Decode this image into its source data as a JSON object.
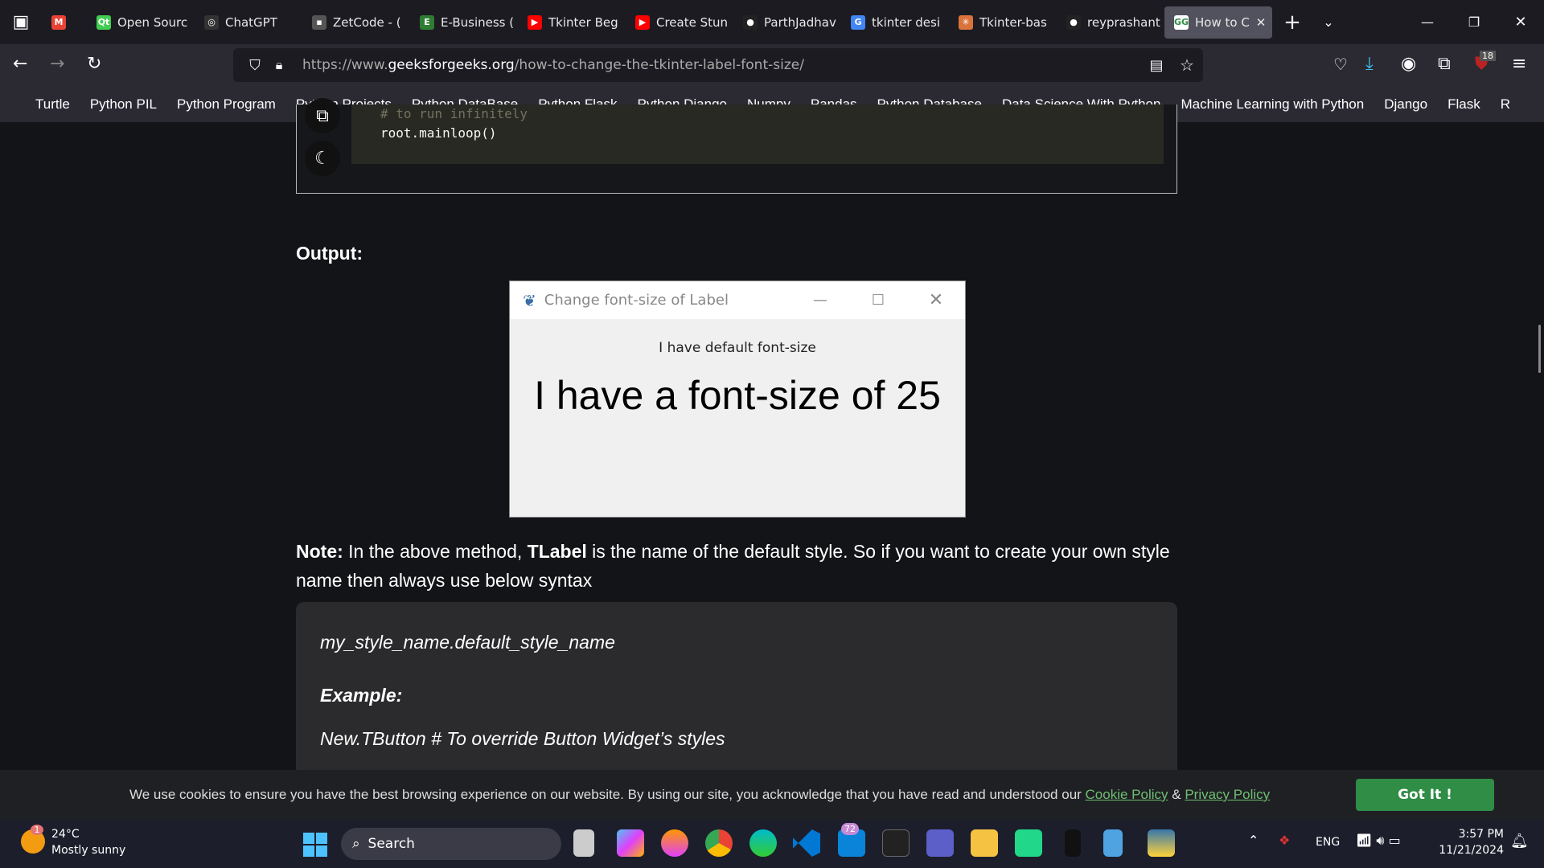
{
  "tabs": [
    {
      "label": "",
      "color": "#e94235",
      "icon": "M"
    },
    {
      "label": "Open Sourc",
      "color": "#41cd52",
      "icon": "Qt"
    },
    {
      "label": "ChatGPT",
      "color": "#333",
      "icon": "◎"
    },
    {
      "label": "ZetCode - (",
      "color": "#555",
      "icon": "▪"
    },
    {
      "label": "E-Business (",
      "color": "#2e7d32",
      "icon": "E"
    },
    {
      "label": "Tkinter Beg",
      "color": "#f00",
      "icon": "▶"
    },
    {
      "label": "Create Stun",
      "color": "#f00",
      "icon": "▶"
    },
    {
      "label": "ParthJadhav",
      "color": "#222",
      "icon": "●"
    },
    {
      "label": "tkinter desi",
      "color": "#4285f4",
      "icon": "G"
    },
    {
      "label": "Tkinter-bas",
      "color": "#d9733b",
      "icon": "✳"
    },
    {
      "label": "reyprashant",
      "color": "#222",
      "icon": "●"
    },
    {
      "label": "How to C",
      "color": "#fff",
      "icon": "GG",
      "active": true
    }
  ],
  "url": {
    "prefix": "https://www.",
    "domain": "geeksforgeeks.org",
    "path": "/how-to-change-the-tkinter-label-font-size/"
  },
  "extensions_badge": "18",
  "bookmarks": [
    "Turtle",
    "Python PIL",
    "Python Program",
    "Python Projects",
    "Python DataBase",
    "Python Flask",
    "Python Django",
    "Numpy",
    "Pandas",
    "Python Database",
    "Data Science With Python",
    "Machine Learning with Python",
    "Django",
    "Flask",
    "R"
  ],
  "code": {
    "comment": "# to run infinitely",
    "line": "root.mainloop()"
  },
  "output_heading": "Output:",
  "tk_window": {
    "title": "Change font-size of Label",
    "label_default": "I have default font-size",
    "label_big": "I have a font-size of 25"
  },
  "note": {
    "bold": "Note:",
    "text1": " In the above method, ",
    "bold2": "TLabel",
    "text2": " is the name of the default style. So if you want to create your own style name then always use below syntax"
  },
  "syntax": {
    "line1": "my_style_name.default_style_name",
    "example_label": "Example:",
    "line2": "New.TButton  # To override Button Widget’s styles"
  },
  "cookie": {
    "text": "We use cookies to ensure you have the best browsing experience on our website. By using our site, you acknowledge that you have read and understood our ",
    "cookie_link": "Cookie Policy",
    "amp": " & ",
    "privacy_link": "Privacy Policy",
    "button": "Got It !"
  },
  "taskbar": {
    "weather_temp": "24°C",
    "weather_desc": "Mostly sunny",
    "weather_badge": "1",
    "search": "Search",
    "mail_badge": "72",
    "lang": "ENG",
    "time": "3:57 PM",
    "date": "11/21/2024"
  }
}
